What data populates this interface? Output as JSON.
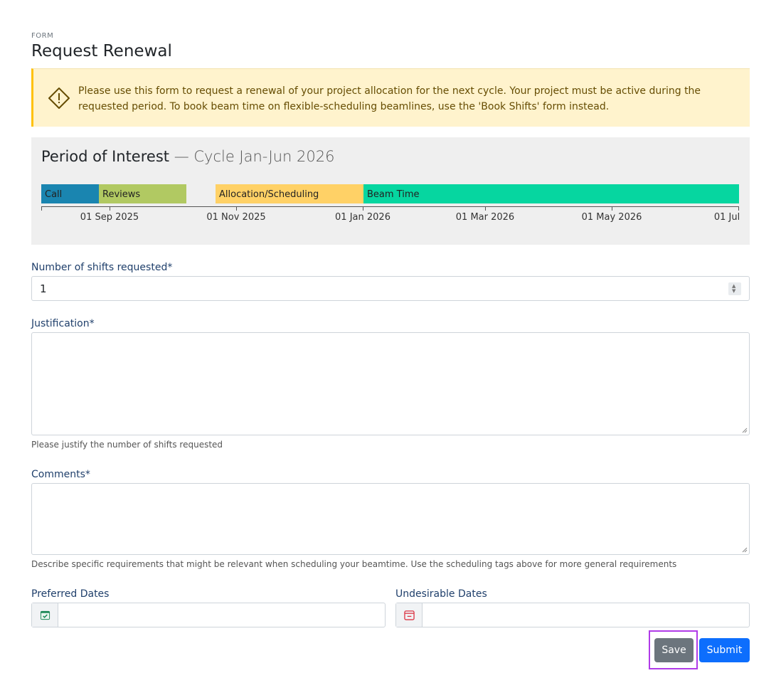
{
  "header": {
    "eyebrow": "FORM",
    "title": "Request Renewal"
  },
  "alert": {
    "icon": "warning-diamond-icon",
    "text": "Please use this form to request a renewal of your project allocation for the next cycle. Your project must be active during the requested period. To book beam time on flexible-scheduling beamlines, use the 'Book Shifts' form instead."
  },
  "period": {
    "title": "Period of Interest",
    "subtitle": "— Cycle Jan-Jun 2026",
    "phases": [
      {
        "label": "Call",
        "color": "#1a85b0"
      },
      {
        "label": "Reviews",
        "color": "#b1c962"
      },
      {
        "label": "Allocation/Scheduling",
        "color": "#ffd166"
      },
      {
        "label": "Beam Time",
        "color": "#06d6a0"
      }
    ],
    "ticks": [
      "01 Sep 2025",
      "01 Nov 2025",
      "01 Jan 2026",
      "01 Mar 2026",
      "01 May 2026",
      "01 Jul"
    ]
  },
  "fields": {
    "shifts": {
      "label": "Number of shifts requested*",
      "value": "1"
    },
    "justification": {
      "label": "Justification*",
      "value": "",
      "help": "Please justify the number of shifts requested"
    },
    "comments": {
      "label": "Comments*",
      "value": "",
      "help": "Describe specific requirements that might be relevant when scheduling your beamtime. Use the scheduling tags above for more general requirements"
    },
    "preferred_dates": {
      "label": "Preferred Dates",
      "value": "",
      "icon": "calendar-check-icon",
      "icon_color": "#198754"
    },
    "undesirable_dates": {
      "label": "Undesirable Dates",
      "value": "",
      "icon": "calendar-minus-icon",
      "icon_color": "#dc3545"
    }
  },
  "actions": {
    "save_label": "Save",
    "submit_label": "Submit"
  },
  "colors": {
    "primary": "#0d6efd",
    "secondary": "#6c757d",
    "label": "#1f3f6b",
    "warning_bg": "#fff3cd"
  }
}
